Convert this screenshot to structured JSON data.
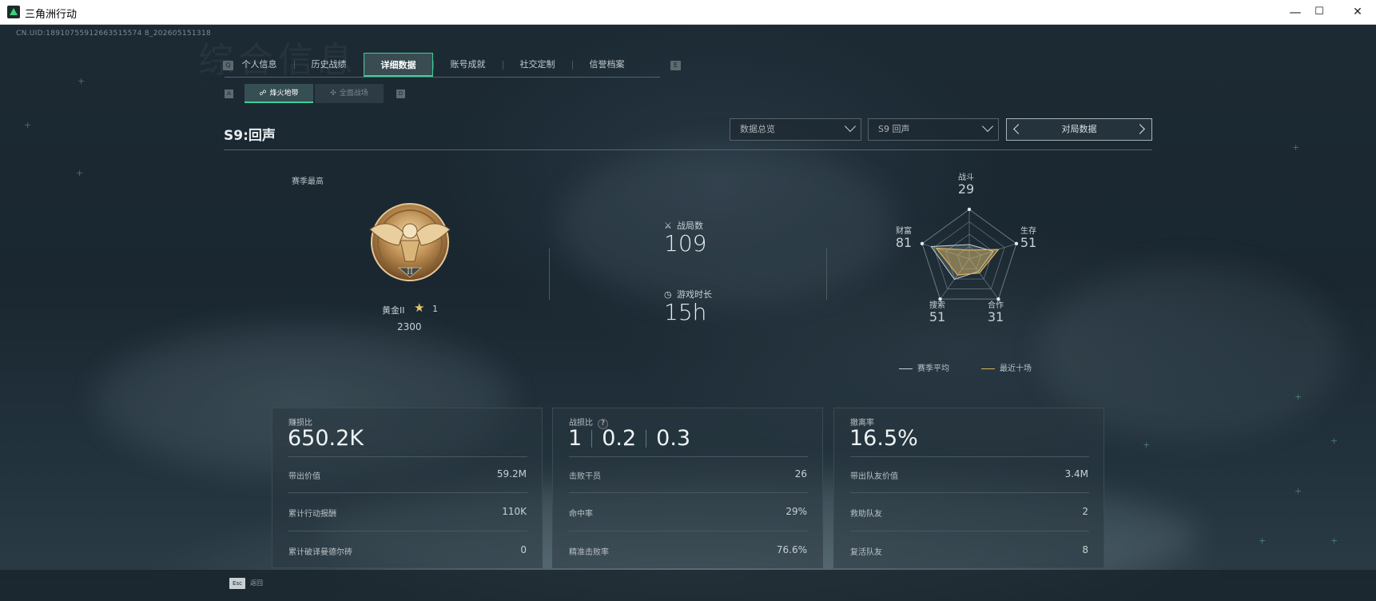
{
  "window": {
    "title": "三角洲行动",
    "minimize": "—",
    "maximize": "☐",
    "close": "✕"
  },
  "uid": "CN.UID:18910755912663515574 8_202605151318",
  "watermark": "综合信息",
  "tabs": {
    "left_key": "Q",
    "right_key": "E",
    "items": [
      {
        "label": "个人信息"
      },
      {
        "label": "历史战绩"
      },
      {
        "label": "详细数据"
      },
      {
        "label": "账号成就"
      },
      {
        "label": "社交定制"
      },
      {
        "label": "信誉档案"
      }
    ],
    "active_index": 2
  },
  "subtabs": {
    "left_key": "A",
    "right_key": "D",
    "active": "烽火地带",
    "inactive": "全面战场"
  },
  "season": {
    "title": "S9:回声"
  },
  "filters": {
    "data_overview": "数据总览",
    "season_select": "S9 回声",
    "match_data": "对局数据"
  },
  "rank": {
    "season_best_label": "赛季最高",
    "name": "黄金II",
    "stars": "1",
    "score": "2300",
    "emblem_numeral": "II"
  },
  "overview": {
    "matches_label": "战局数",
    "matches_value": "109",
    "playtime_label": "游戏时长",
    "playtime_value": "15h"
  },
  "radar": {
    "axes": [
      {
        "label": "战斗",
        "value": "29"
      },
      {
        "label": "生存",
        "value": "51"
      },
      {
        "label": "合作",
        "value": "31"
      },
      {
        "label": "搜索",
        "value": "51"
      },
      {
        "label": "财富",
        "value": "81"
      }
    ],
    "season_avg_fraction": [
      0.29,
      0.51,
      0.31,
      0.51,
      0.81
    ],
    "recent_fraction": [
      0.18,
      0.62,
      0.35,
      0.4,
      0.7
    ],
    "legend_avg": "赛季平均",
    "legend_recent": "最近十场",
    "colors": {
      "avg": "#c8d0d3",
      "recent": "#d8b15a"
    }
  },
  "cards": [
    {
      "title": "赚损比",
      "big": "650.2K",
      "rows": [
        {
          "label": "带出价值",
          "value": "59.2M"
        },
        {
          "label": "累计行动报酬",
          "value": "110K"
        },
        {
          "label": "累计破译曼德尔砖",
          "value": "0"
        }
      ]
    },
    {
      "title": "战损比",
      "help": "?",
      "big_parts": [
        "1",
        "0.2",
        "0.3"
      ],
      "rows": [
        {
          "label": "击败干员",
          "value": "26"
        },
        {
          "label": "命中率",
          "value": "29%"
        },
        {
          "label": "精准击败率",
          "value": "76.6%"
        }
      ]
    },
    {
      "title": "撤离率",
      "big": "16.5%",
      "rows": [
        {
          "label": "带出队友价值",
          "value": "3.4M"
        },
        {
          "label": "救助队友",
          "value": "2"
        },
        {
          "label": "复活队友",
          "value": "8"
        }
      ]
    }
  ],
  "footer": {
    "esc_key": "Esc",
    "back_label": "返回"
  },
  "colors": {
    "accent": "#3fcf98",
    "gold": "#d8b15a"
  }
}
